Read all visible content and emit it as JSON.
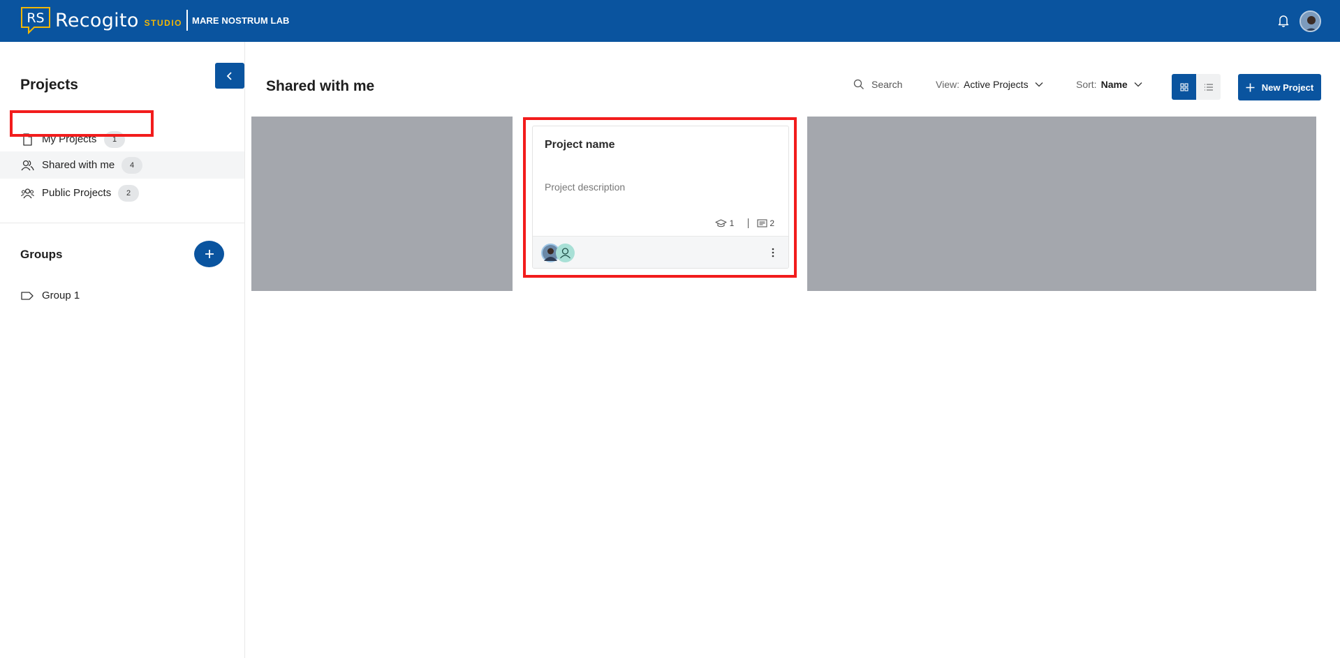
{
  "header": {
    "logo_mark": "RS",
    "app_name": "Recogito",
    "app_suffix": "STUDIO",
    "org_name": "MARE NOSTRUM LAB",
    "icons": [
      "bell-icon",
      "user-avatar"
    ]
  },
  "sidebar": {
    "title": "Projects",
    "items": [
      {
        "label": "My Projects",
        "count": "1",
        "icon": "document-icon"
      },
      {
        "label": "Shared with me",
        "count": "4",
        "icon": "users-icon",
        "active": true
      },
      {
        "label": "Public Projects",
        "count": "2",
        "icon": "group-icon"
      }
    ],
    "groups_title": "Groups",
    "groups": [
      {
        "label": "Group 1",
        "icon": "tag-icon"
      }
    ]
  },
  "main": {
    "title": "Shared with me",
    "search_placeholder": "Search",
    "view_label": "View:",
    "view_value": "Active Projects",
    "sort_label": "Sort:",
    "sort_value": "Name",
    "new_project_label": "New Project"
  },
  "card": {
    "title": "Project name",
    "description": "Project description",
    "assignments_count": "1",
    "documents_count": "2"
  },
  "colors": {
    "brand_blue": "#0a549f",
    "studio_yellow": "#f2b705",
    "highlight_red": "#f21c1c",
    "overlay_grey": "#a4a7ad"
  }
}
